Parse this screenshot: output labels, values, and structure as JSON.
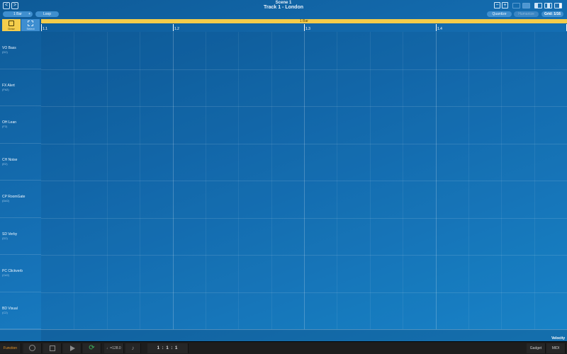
{
  "header": {
    "scene_title": "Scene 1",
    "track_title": "Track 1 - London",
    "back_label": "<",
    "forward_label": ">"
  },
  "toolbar": {
    "bar_length": "1 Bar",
    "bar_plus": "+",
    "loop_label": "Loop",
    "quantize_label": "Quantize",
    "humanize_label": "Humanize",
    "grid_label": "Grid: 1/16",
    "zoom_out_label": "−",
    "zoom_in_label": "+"
  },
  "tools": {
    "draw_label": "Draw",
    "select_label": "Select"
  },
  "region": {
    "label": "1 Bar",
    "ruler_labels": [
      "1.1",
      "1.2",
      "1.3",
      "1.4"
    ]
  },
  "lanes": [
    {
      "name": "VO Bass",
      "note": "(D2)"
    },
    {
      "name": "FX Alert",
      "note": "(F#2)"
    },
    {
      "name": "OH Lean",
      "note": "(F2)"
    },
    {
      "name": "CH Noise",
      "note": "(E2)"
    },
    {
      "name": "CP RoomGate",
      "note": "(D#2)"
    },
    {
      "name": "SD Verby",
      "note": "(D2)"
    },
    {
      "name": "PC Clickverb",
      "note": "(C#2)"
    },
    {
      "name": "BD Visual",
      "note": "(C2)"
    }
  ],
  "velocity": {
    "label": "Velocity"
  },
  "transport": {
    "function_label": "Function",
    "loop_glyph": "⟳",
    "tempo": "♩=128.0",
    "metronome_glyph": "♪",
    "position": "1 :   1 :   1",
    "gadget_label": "Gadget",
    "midi_label": "MIDI"
  },
  "colors": {
    "accent_yellow": "#f4cc4a",
    "function_orange": "#e8962a",
    "loop_green": "#3fb45f",
    "background_blue": "#1570b5"
  }
}
